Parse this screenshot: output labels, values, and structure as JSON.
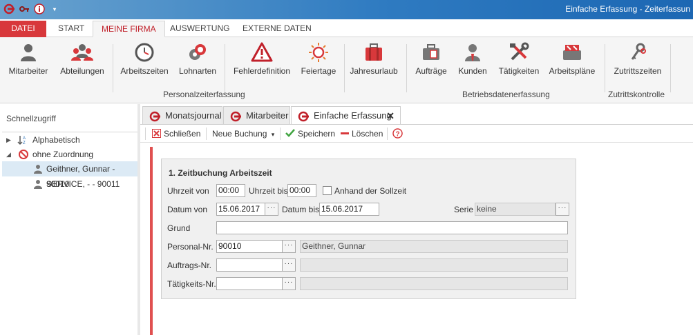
{
  "window": {
    "title": "Einfache Erfassung - Zeiterfassun"
  },
  "ribbon_tabs": [
    "DATEI",
    "START",
    "MEINE FIRMA",
    "AUSWERTUNG",
    "EXTERNE DATEN"
  ],
  "ribbon": {
    "buttons": [
      "Mitarbeiter",
      "Abteilungen",
      "Arbeitszeiten",
      "Lohnarten",
      "Fehlerdefinition",
      "Feiertage",
      "Jahresurlaub",
      "Aufträge",
      "Kunden",
      "Tätigkeiten",
      "Arbeitspläne",
      "Zutrittszeiten"
    ],
    "groups": [
      "Personalzeiterfassung",
      "Betriebsdatenerfassung",
      "Zutrittskontrolle"
    ]
  },
  "sidebar": {
    "title": "Schnellzugriff",
    "items": [
      {
        "label": "Alphabetisch"
      },
      {
        "label": "ohne Zuordnung"
      },
      {
        "label": "Geithner, Gunnar  - 90010"
      },
      {
        "label": "SERVICE, - - 90011"
      }
    ]
  },
  "doc_tabs": [
    "Monatsjournal",
    "Mitarbeiter",
    "Einfache Erfassung"
  ],
  "toolbar": {
    "close": "Schließen",
    "new_booking": "Neue Buchung",
    "save": "Speichern",
    "delete": "Löschen"
  },
  "form": {
    "title": "1. Zeitbuchung Arbeitszeit",
    "time_from_label": "Uhrzeit von",
    "time_from": "00:00",
    "time_to_label": "Uhrzeit bis",
    "time_to": "00:00",
    "target_label": "Anhand der Sollzeit",
    "date_from_label": "Datum von",
    "date_from": "15.06.2017",
    "date_to_label": "Datum bis",
    "date_to": "15.06.2017",
    "series_label": "Serie",
    "series_value": "keine",
    "reason_label": "Grund",
    "reason_value": "",
    "personnel_label": "Personal-Nr.",
    "personnel_value": "90010",
    "personnel_name": "Geithner, Gunnar",
    "order_label": "Auftrags-Nr.",
    "order_value": "",
    "activity_label": "Tätigkeits-Nr.",
    "activity_value": ""
  },
  "colors": {
    "accent": "#d8383b",
    "titlebar": "#2f7bc1",
    "selection": "#dceaf5"
  }
}
